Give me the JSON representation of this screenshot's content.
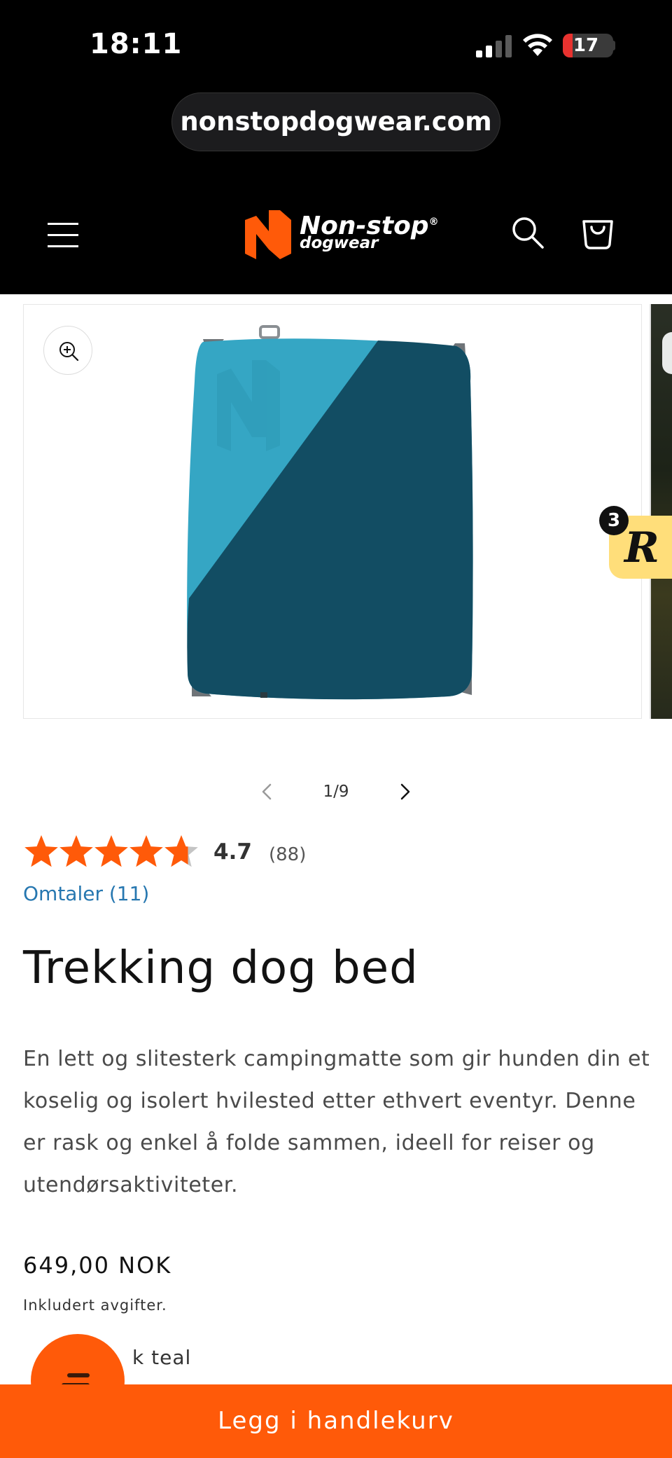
{
  "status_bar": {
    "time": "18:11",
    "battery_level": "17",
    "battery_color": "#e8322f"
  },
  "browser": {
    "url": "nonstopdogwear.com"
  },
  "header": {
    "logo_text": "Non-stop",
    "logo_subtext": "dogwear",
    "brand_color": "#ff5a09",
    "icons": [
      "menu-icon",
      "search-icon",
      "cart-icon"
    ]
  },
  "gallery": {
    "counter": "1/9",
    "reviews_badge_count": "3",
    "reviews_badge_letter": "R"
  },
  "rating": {
    "value": "4.7",
    "count": "(88)",
    "stars_filled": 4.7,
    "stars_total": 5,
    "reviews_link": "Omtaler (11)",
    "star_color": "#ff5a09",
    "link_color": "#2677b0"
  },
  "product": {
    "title": "Trekking dog bed",
    "description": "En lett og slitesterk campingmatte som gir hunden din et koselig og isolert hvilested etter ethvert eventyr. Denne er rask og enkel å folde sammen, ideell for reiser og utendørsaktiviteter.",
    "price": "649,00 NOK",
    "tax_note": "Inkludert avgifter.",
    "color_label": "k teal"
  },
  "cta": {
    "add_to_cart": "Legg i handlekurv"
  }
}
